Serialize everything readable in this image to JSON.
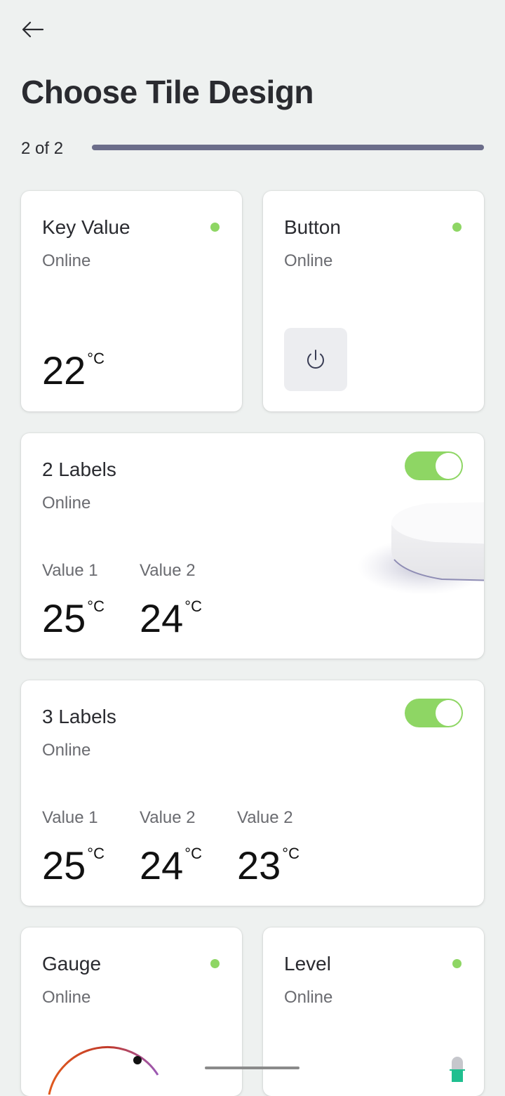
{
  "header": {
    "title": "Choose Tile Design",
    "step": "2 of 2",
    "progress": 1.0
  },
  "colors": {
    "online_dot": "#8ed664",
    "toggle_on": "#8ed664",
    "progress_fill": "#6b6d8a",
    "background": "#eef1f0"
  },
  "icons": {
    "back": "arrow-left-icon",
    "power": "power-icon"
  },
  "tiles": {
    "key_value": {
      "title": "Key Value",
      "status": "Online",
      "value": "22",
      "unit": "°C"
    },
    "button": {
      "title": "Button",
      "status": "Online"
    },
    "two_labels": {
      "title": "2 Labels",
      "status": "Online",
      "toggle_on": true,
      "values": [
        {
          "label": "Value 1",
          "value": "25",
          "unit": "°C"
        },
        {
          "label": "Value 2",
          "value": "24",
          "unit": "°C"
        }
      ]
    },
    "three_labels": {
      "title": "3 Labels",
      "status": "Online",
      "toggle_on": true,
      "values": [
        {
          "label": "Value 1",
          "value": "25",
          "unit": "°C"
        },
        {
          "label": "Value 2",
          "value": "24",
          "unit": "°C"
        },
        {
          "label": "Value 2",
          "value": "23",
          "unit": "°C"
        }
      ]
    },
    "gauge": {
      "title": "Gauge",
      "status": "Online"
    },
    "level": {
      "title": "Level",
      "status": "Online"
    }
  }
}
